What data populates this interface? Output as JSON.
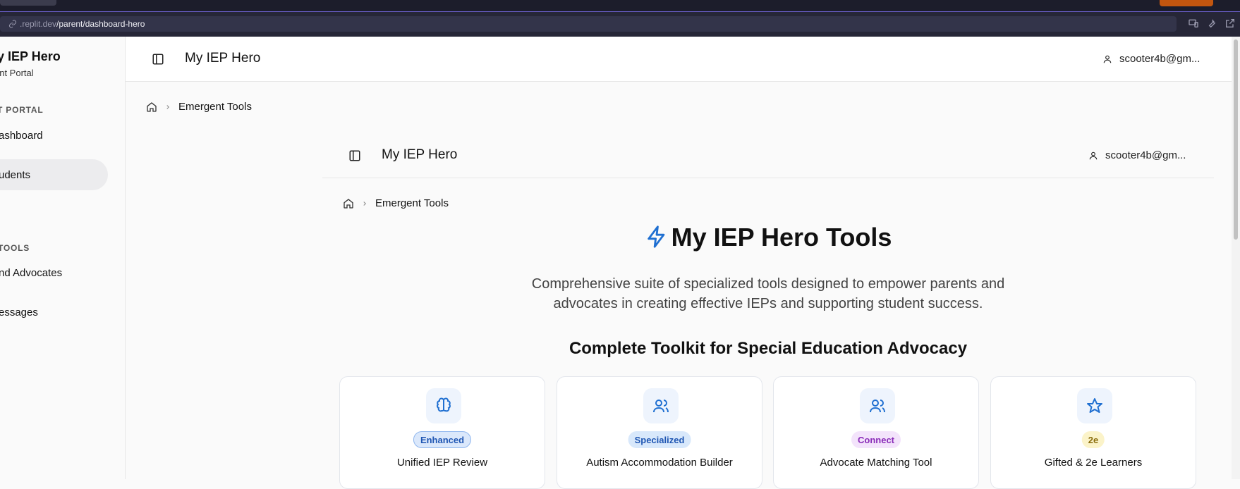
{
  "browser": {
    "url_host": ".replit.dev",
    "url_path": "/parent/dashboard-hero"
  },
  "sidebar": {
    "title": "y IEP Hero",
    "subtitle": "ent Portal",
    "section1": "T PORTAL",
    "items_top": [
      {
        "label": "ashboard"
      },
      {
        "label": "udents"
      }
    ],
    "section2": "TOOLS",
    "items_bottom": [
      {
        "label": "nd Advocates"
      },
      {
        "label": "essages"
      }
    ]
  },
  "header": {
    "title": "My IEP Hero",
    "user": "scooter4b@gm..."
  },
  "breadcrumb": {
    "current": "Emergent Tools"
  },
  "inner": {
    "header": {
      "title": "My IEP Hero",
      "user": "scooter4b@gm..."
    },
    "breadcrumb": {
      "current": "Emergent Tools"
    },
    "hero": {
      "title": "My IEP Hero Tools",
      "description": "Comprehensive suite of specialized tools designed to empower parents and advocates in creating effective IEPs and supporting student success."
    },
    "section_heading": "Complete Toolkit for Special Education Advocacy",
    "cards": [
      {
        "badge": "Enhanced",
        "title": "Unified IEP Review",
        "icon": "brain-icon"
      },
      {
        "badge": "Specialized",
        "title": "Autism Accommodation Builder",
        "icon": "users-icon"
      },
      {
        "badge": "Connect",
        "title": "Advocate Matching Tool",
        "icon": "users-icon"
      },
      {
        "badge": "2e",
        "title": "Gifted & 2e Learners",
        "icon": "star-icon"
      }
    ]
  },
  "colors": {
    "accent_blue": "#1f6fd1",
    "badge_enhanced_bg": "#dbe8fb",
    "badge_specialized_bg": "#d8e8fb",
    "badge_connect_bg": "#f3e3fb",
    "badge_2e_bg": "#fbf3c9"
  }
}
